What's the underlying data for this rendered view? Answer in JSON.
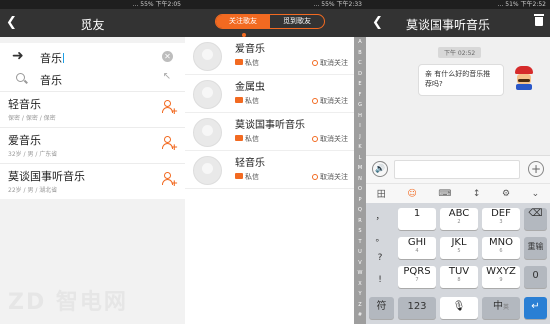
{
  "status": {
    "p1": "… 55% 下午2:05",
    "p2": "… 55% 下午2:33",
    "p3": "… 51% 下午2:52"
  },
  "search_panel": {
    "title": "觅友",
    "query": "音乐",
    "suggestion": "音乐",
    "results": [
      {
        "name": "轻音乐",
        "sub": "保密 / 保密 / 保密"
      },
      {
        "name": "爱音乐",
        "sub": "32岁 / 男 / 广东省"
      },
      {
        "name": "莫谈国事听音乐",
        "sub": "22岁 / 男 / 湖北省"
      }
    ],
    "watermark": "ZD 智电网"
  },
  "friends_panel": {
    "tabs": [
      "关注歌友",
      "觅到歌友"
    ],
    "message_label": "私信",
    "unfollow_label": "取消关注",
    "friends": [
      "爱音乐",
      "金属虫",
      "莫谈国事听音乐",
      "轻音乐"
    ],
    "index_letters": [
      "A",
      "B",
      "C",
      "D",
      "E",
      "F",
      "G",
      "H",
      "I",
      "J",
      "K",
      "L",
      "M",
      "N",
      "O",
      "P",
      "Q",
      "R",
      "S",
      "T",
      "U",
      "V",
      "W",
      "X",
      "Y",
      "Z",
      "#"
    ]
  },
  "chat_panel": {
    "title": "莫谈国事听音乐",
    "timestamp": "下午 02:52",
    "message": "亲 有什么好的音乐推荐吗?",
    "toolbar": [
      "田",
      "☺",
      "⌨",
      "↕",
      "⚙",
      "⌄"
    ],
    "keyboard": {
      "punct": [
        "，",
        "。",
        "?",
        "!"
      ],
      "keys": [
        {
          "big": "1",
          "sm": ""
        },
        {
          "big": "ABC",
          "sm": "2"
        },
        {
          "big": "DEF",
          "sm": "3"
        },
        {
          "big": "GHI",
          "sm": "4"
        },
        {
          "big": "JKL",
          "sm": "5"
        },
        {
          "big": "MNO",
          "sm": "6"
        },
        {
          "big": "PQRS",
          "sm": "7"
        },
        {
          "big": "TUV",
          "sm": "8"
        },
        {
          "big": "WXYZ",
          "sm": "9"
        }
      ],
      "reinput": "重输",
      "zero": "0",
      "sym": "符",
      "num": "123",
      "lang": "中",
      "lang_sub": "英"
    }
  }
}
